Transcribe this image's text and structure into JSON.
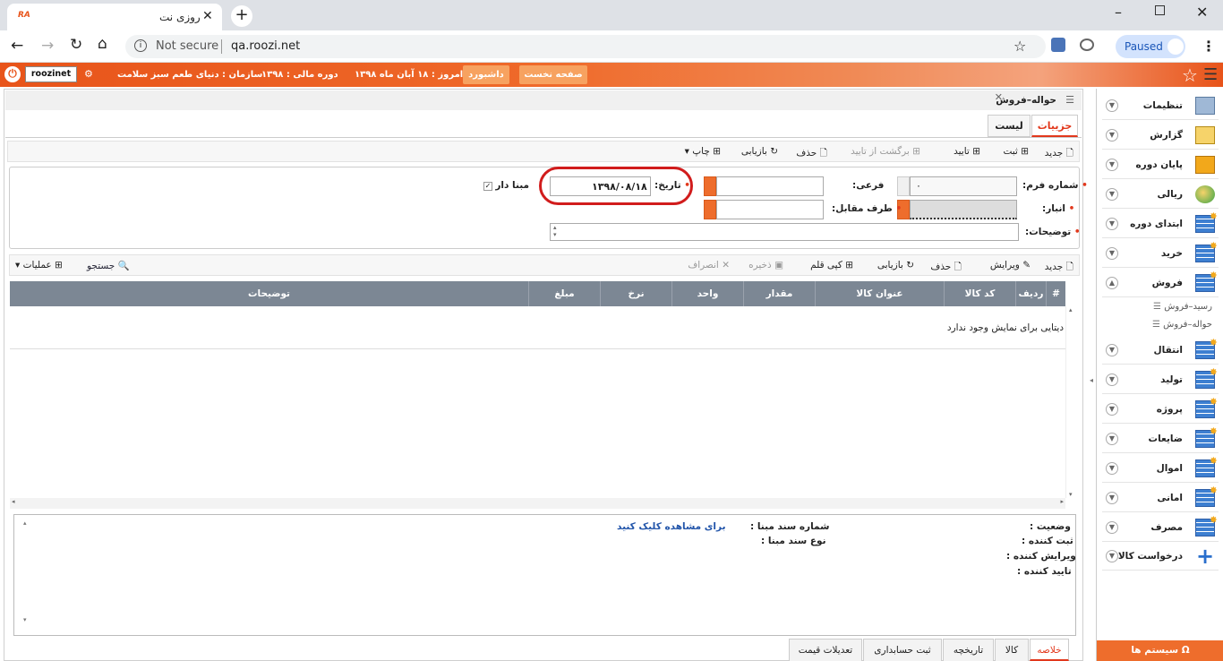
{
  "browser": {
    "tab_title": "روزی نت",
    "url_host": "qa.roozi.net",
    "not_secure": "Not secure",
    "paused": "Paused"
  },
  "header": {
    "home_btn": "صفحه نخست",
    "dashboard_btn": "داشبورد",
    "today": "امروز : ۱۸ آبان ماه ۱۳۹۸",
    "period": "دوره مالی : ۱۳۹۸",
    "org": "سازمان : دنیای طعم سبز سلامت",
    "user": "roozinet"
  },
  "sidebar": {
    "items": [
      {
        "label": "تنظیمات",
        "icon": "settings-folder-icon"
      },
      {
        "label": "گزارش",
        "icon": "report-clipboard-icon"
      },
      {
        "label": "پایان دوره",
        "icon": "period-end-icon"
      },
      {
        "label": "ریالی",
        "icon": "currency-coins-icon"
      },
      {
        "label": "ابتدای دوره",
        "icon": "grid-star-icon"
      },
      {
        "label": "خرید",
        "icon": "grid-star-icon"
      },
      {
        "label": "فروش",
        "icon": "grid-star-icon"
      },
      {
        "label": "انتقال",
        "icon": "grid-star-icon"
      },
      {
        "label": "تولید",
        "icon": "grid-star-icon"
      },
      {
        "label": "پروژه",
        "icon": "grid-star-icon"
      },
      {
        "label": "ضایعات",
        "icon": "grid-star-icon"
      },
      {
        "label": "اموال",
        "icon": "grid-star-icon"
      },
      {
        "label": "امانی",
        "icon": "grid-star-icon"
      },
      {
        "label": "مصرف",
        "icon": "grid-star-icon"
      },
      {
        "label": "درخواست کالا",
        "icon": "plus-icon"
      }
    ],
    "sub_items": [
      "رسید–فروش",
      "حواله–فروش"
    ],
    "system_btn": "سیستم ها"
  },
  "page": {
    "title": "حواله–فروش",
    "tab_details": "جزییات",
    "tab_list": "لیست"
  },
  "toolbar": {
    "new": "جدید",
    "save": "ثبت",
    "confirm": "تایید",
    "revert": "برگشت از تایید",
    "delete": "حذف",
    "refresh": "بازیابی",
    "print": "چاپ"
  },
  "form": {
    "form_no_label": "شماره فرم:",
    "form_no_value": "۰",
    "sub_label": "فرعی:",
    "date_label": "تاریخ:",
    "date_value": "۱۳۹۸/۰۸/۱۸",
    "based_label": "مبنا دار",
    "warehouse_label": "انبار:",
    "party_label": "طرف مقابل:",
    "desc_label": "توضیحات:"
  },
  "grid_toolbar": {
    "new": "جدید",
    "edit": "ویرایش",
    "delete": "حذف",
    "refresh": "بازیابی",
    "copy_row": "کپی قلم",
    "save": "ذخیره",
    "cancel": "انصراف",
    "search": "جستجو",
    "ops": "عملیات"
  },
  "grid": {
    "headers": [
      "#",
      "ردیف",
      "کد کالا",
      "عنوان کالا",
      "مقدار",
      "واحد",
      "نرخ",
      "مبلغ",
      "توضیحات"
    ],
    "empty": "دیتایی برای نمایش وجود ندارد"
  },
  "summary": {
    "status": "وضعیت :",
    "registered_by": "ثبت کننده :",
    "edited_by": "ویرایش کننده :",
    "confirmed_by": "تایید کننده :",
    "source_doc_no": "شماره سند مبنا :",
    "source_doc_type": "نوع سند مبنا :",
    "click_to_view": "برای مشاهده کلیک کنید"
  },
  "bottom_tabs": [
    "خلاصه",
    "کالا",
    "تاریخچه",
    "ثبت حسابداری",
    "تعدیلات قیمت"
  ],
  "colors": {
    "accent": "#e8541a",
    "grid_header": "#7c8794",
    "active_tab": "#e2381c",
    "link": "#2255aa"
  }
}
